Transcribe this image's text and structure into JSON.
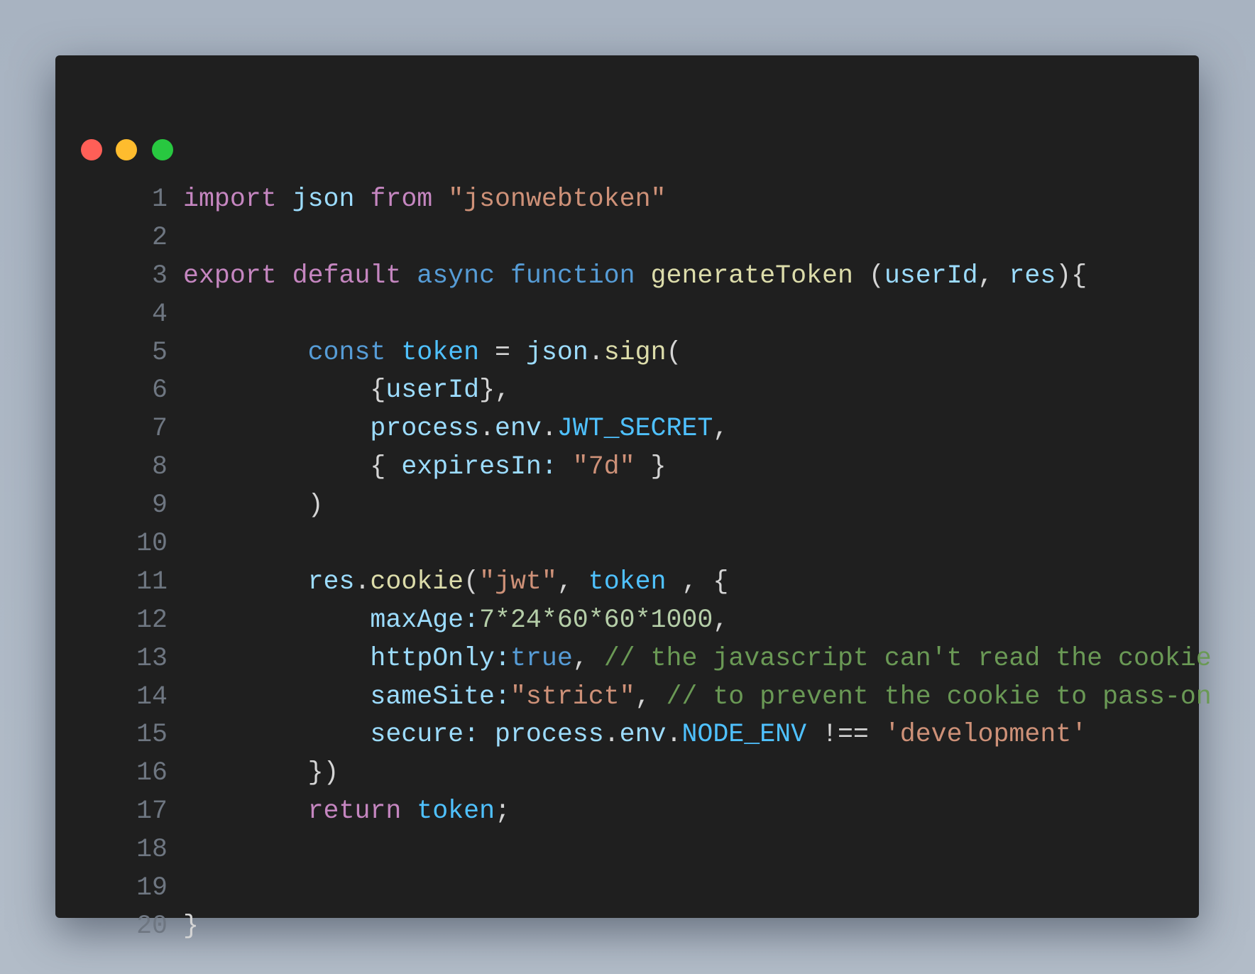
{
  "window": {
    "buttons": [
      {
        "name": "close",
        "color": "#ff5f57"
      },
      {
        "name": "minimize",
        "color": "#febc2e"
      },
      {
        "name": "maximize",
        "color": "#28c840"
      }
    ]
  },
  "code": {
    "lines": [
      {
        "n": "1",
        "tokens": [
          [
            "import",
            "kw"
          ],
          [
            " ",
            "p"
          ],
          [
            "json",
            "var"
          ],
          [
            " ",
            "p"
          ],
          [
            "from",
            "kw"
          ],
          [
            " ",
            "p"
          ],
          [
            "\"jsonwebtoken\"",
            "str"
          ]
        ]
      },
      {
        "n": "2",
        "tokens": []
      },
      {
        "n": "3",
        "tokens": [
          [
            "export",
            "kw"
          ],
          [
            " ",
            "p"
          ],
          [
            "default",
            "kw"
          ],
          [
            " ",
            "p"
          ],
          [
            "async",
            "st"
          ],
          [
            " ",
            "p"
          ],
          [
            "function",
            "st"
          ],
          [
            " ",
            "p"
          ],
          [
            "generateToken",
            "fn"
          ],
          [
            " (",
            "p"
          ],
          [
            "userId",
            "var"
          ],
          [
            ", ",
            "p"
          ],
          [
            "res",
            "var"
          ],
          [
            "){",
            "p"
          ]
        ]
      },
      {
        "n": "4",
        "tokens": []
      },
      {
        "n": "5",
        "tokens": [
          [
            "        ",
            "p"
          ],
          [
            "const",
            "st"
          ],
          [
            " ",
            "p"
          ],
          [
            "token",
            "const"
          ],
          [
            " = ",
            "p"
          ],
          [
            "json",
            "var"
          ],
          [
            ".",
            "p"
          ],
          [
            "sign",
            "fn"
          ],
          [
            "(",
            "p"
          ]
        ]
      },
      {
        "n": "6",
        "tokens": [
          [
            "            {",
            "p"
          ],
          [
            "userId",
            "var"
          ],
          [
            "},",
            "p"
          ]
        ]
      },
      {
        "n": "7",
        "tokens": [
          [
            "            ",
            "p"
          ],
          [
            "process",
            "var"
          ],
          [
            ".",
            "p"
          ],
          [
            "env",
            "var"
          ],
          [
            ".",
            "p"
          ],
          [
            "JWT_SECRET",
            "const"
          ],
          [
            ",",
            "p"
          ]
        ]
      },
      {
        "n": "8",
        "tokens": [
          [
            "            { ",
            "p"
          ],
          [
            "expiresIn",
            "var"
          ],
          [
            ": ",
            "var"
          ],
          [
            "\"7d\"",
            "str"
          ],
          [
            " }",
            "p"
          ]
        ]
      },
      {
        "n": "9",
        "tokens": [
          [
            "        )",
            "p"
          ]
        ]
      },
      {
        "n": "10",
        "tokens": []
      },
      {
        "n": "11",
        "tokens": [
          [
            "        ",
            "p"
          ],
          [
            "res",
            "var"
          ],
          [
            ".",
            "p"
          ],
          [
            "cookie",
            "fn"
          ],
          [
            "(",
            "p"
          ],
          [
            "\"jwt\"",
            "str"
          ],
          [
            ", ",
            "p"
          ],
          [
            "token",
            "const"
          ],
          [
            " , {",
            "p"
          ]
        ]
      },
      {
        "n": "12",
        "tokens": [
          [
            "            ",
            "p"
          ],
          [
            "maxAge:",
            "var"
          ],
          [
            "7*24*60*60*1000",
            "num"
          ],
          [
            ",",
            "p"
          ]
        ]
      },
      {
        "n": "13",
        "tokens": [
          [
            "            ",
            "p"
          ],
          [
            "httpOnly:",
            "var"
          ],
          [
            "true",
            "st"
          ],
          [
            ", ",
            "p"
          ],
          [
            "// the javascript can't read the cookie",
            "cm"
          ]
        ]
      },
      {
        "n": "14",
        "tokens": [
          [
            "            ",
            "p"
          ],
          [
            "sameSite:",
            "var"
          ],
          [
            "\"strict\"",
            "str"
          ],
          [
            ", ",
            "p"
          ],
          [
            "// to prevent the cookie to pass-on",
            "cm"
          ]
        ]
      },
      {
        "n": "15",
        "tokens": [
          [
            "            ",
            "p"
          ],
          [
            "secure: ",
            "var"
          ],
          [
            "process",
            "var"
          ],
          [
            ".",
            "p"
          ],
          [
            "env",
            "var"
          ],
          [
            ".",
            "p"
          ],
          [
            "NODE_ENV",
            "const"
          ],
          [
            " !== ",
            "p"
          ],
          [
            "'development'",
            "str"
          ]
        ]
      },
      {
        "n": "16",
        "tokens": [
          [
            "        })",
            "p"
          ]
        ]
      },
      {
        "n": "17",
        "tokens": [
          [
            "        ",
            "p"
          ],
          [
            "return",
            "kw"
          ],
          [
            " ",
            "p"
          ],
          [
            "token",
            "const"
          ],
          [
            ";",
            "p"
          ]
        ]
      },
      {
        "n": "18",
        "tokens": []
      },
      {
        "n": "19",
        "tokens": []
      },
      {
        "n": "20",
        "tokens": [
          [
            "}",
            "p"
          ]
        ]
      }
    ]
  }
}
